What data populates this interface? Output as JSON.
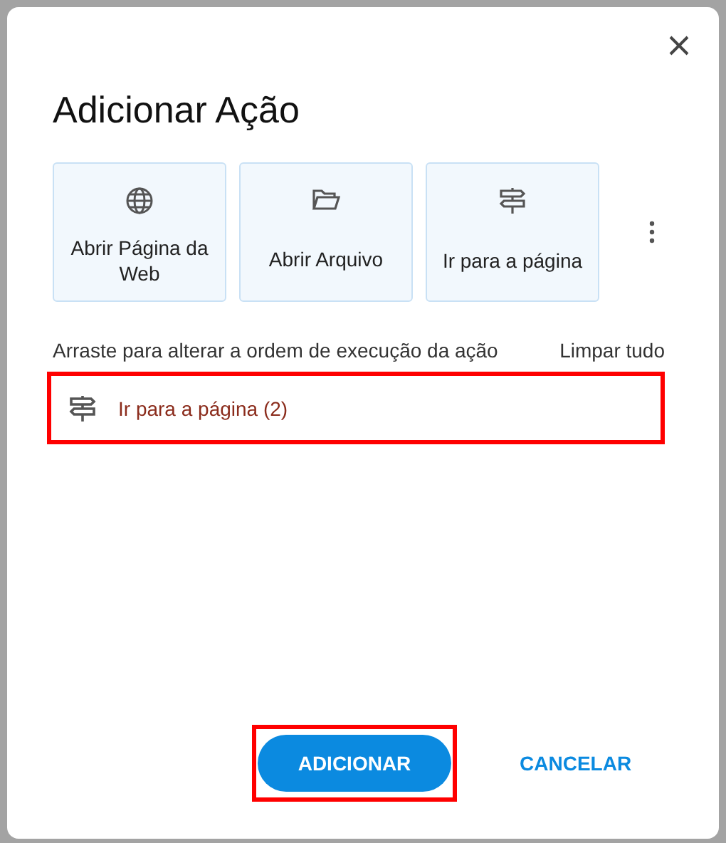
{
  "dialog": {
    "title": "Adicionar Ação",
    "action_types": [
      {
        "label": "Abrir Página da Web",
        "kind": "web"
      },
      {
        "label": "Abrir Arquivo",
        "kind": "file"
      },
      {
        "label": "Ir para a página",
        "kind": "goto"
      }
    ],
    "instruction": "Arraste para alterar a ordem de execução da ação",
    "clear_all": "Limpar tudo",
    "actions": [
      {
        "label": "Ir para a página (2)",
        "kind": "goto",
        "highlighted": true
      }
    ],
    "buttons": [
      {
        "label": "ADICIONAR",
        "kind": "primary",
        "highlighted": true
      },
      {
        "label": "CANCELAR",
        "kind": "text",
        "highlighted": false
      }
    ]
  }
}
